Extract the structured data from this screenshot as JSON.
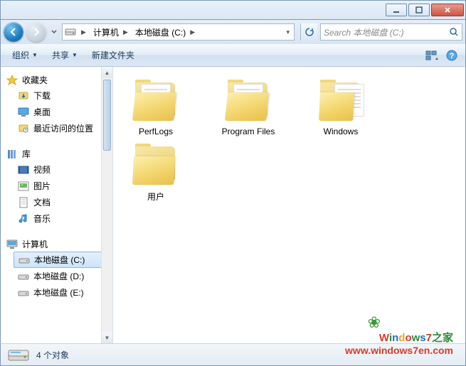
{
  "breadcrumb": {
    "seg1": "计算机",
    "seg2": "本地磁盘 (C:)"
  },
  "search": {
    "placeholder": "Search 本地磁盘 (C:)"
  },
  "toolbar": {
    "organize": "组织",
    "share": "共享",
    "newfolder": "新建文件夹"
  },
  "sidebar": {
    "favorites": {
      "header": "收藏夹",
      "downloads": "下载",
      "desktop": "桌面",
      "recent": "最近访问的位置"
    },
    "libraries": {
      "header": "库",
      "videos": "视频",
      "pictures": "图片",
      "documents": "文档",
      "music": "音乐"
    },
    "computer": {
      "header": "计算机",
      "c": "本地磁盘 (C:)",
      "d": "本地磁盘 (D:)",
      "e": "本地磁盘 (E:)"
    }
  },
  "folders": [
    {
      "name": "PerfLogs",
      "type": "docs"
    },
    {
      "name": "Program Files",
      "type": "docs"
    },
    {
      "name": "Windows",
      "type": "paper"
    },
    {
      "name": "用户",
      "type": "empty"
    }
  ],
  "status": {
    "count": "4 个对象"
  },
  "watermark": {
    "brand": "Windows7",
    "suffix": "之家",
    "url": "www.windows7en.com"
  }
}
